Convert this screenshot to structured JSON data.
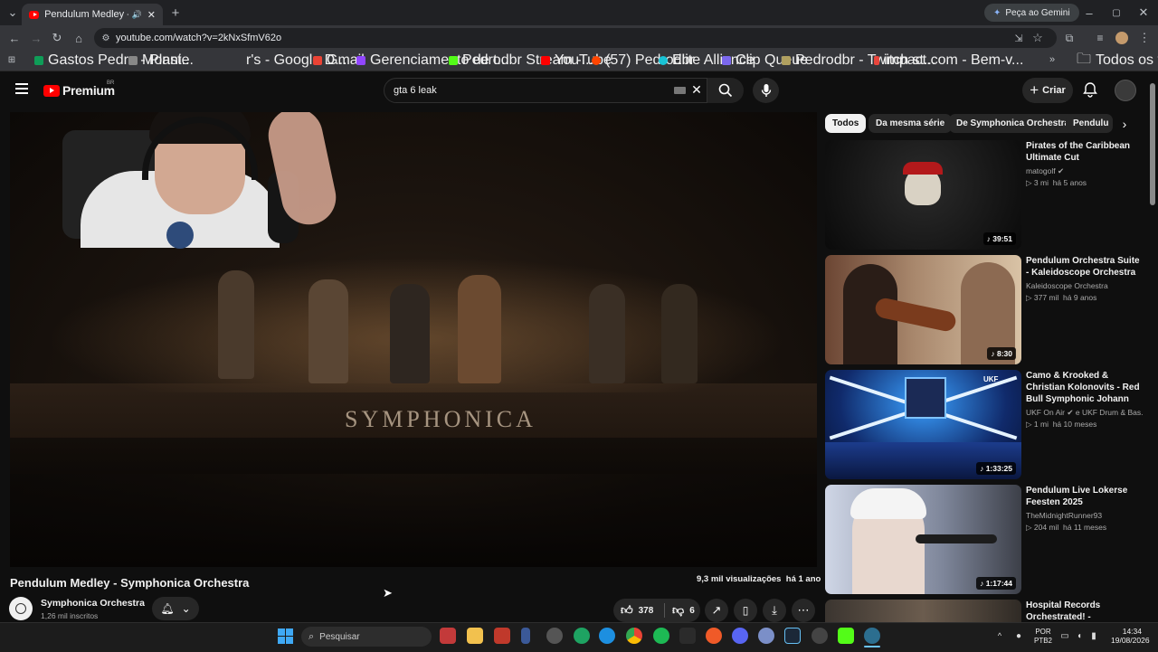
{
  "browser": {
    "tab_title": "Pendulum Medley - Symph",
    "url": "youtube.com/watch?v=2kNxSfmV62o",
    "gemini_label": "Peça ao Gemini",
    "bookmarks": [
      "Gastos Pedro - Plani...",
      "Monste",
      "r's - Google D...",
      "Gmail",
      "Gerenciamento de t...",
      "Pedrodbr Stream -...",
      "YouTube",
      "(57) Pedrodbr",
      "Elite Alliance",
      "Clip Queue",
      "Pedrodbr - Twitch st...",
      "impact.com - Bem-v..."
    ],
    "all_bookmarks": "Todos os favoritos"
  },
  "youtube": {
    "logo_text": "Premium",
    "country": "BR",
    "search_value": "gta 6 leak",
    "create_label": "Criar",
    "chips": [
      "Todos",
      "Da mesma série",
      "De Symphonica Orchestra",
      "Pendulu"
    ],
    "video": {
      "overlay_text": "SYMPHONICA",
      "title": "Pendulum Medley - Symphonica Orchestra",
      "views": "9,3 mil visualizações",
      "age": "há 1 ano",
      "channel": "Symphonica Orchestra",
      "subs": "1,26 mil inscritos",
      "likes": "378",
      "dislikes": "6"
    },
    "recommendations": [
      {
        "title": "Pirates of the Caribbean Ultimate Cut",
        "channel": "matogolf",
        "verified": true,
        "views": "3 mi",
        "age": "há 5 anos",
        "duration": "39:51"
      },
      {
        "title": "Pendulum Orchestra Suite - Kaleidoscope Orchestra",
        "channel": "Kaleidoscope Orchestra",
        "verified": false,
        "views": "377 mil",
        "age": "há 9 anos",
        "duration": "8:30"
      },
      {
        "title": "Camo & Krooked & Christian Kolonovits - Red Bull Symphonic Johann Strauss ...",
        "channel": "UKF On Air",
        "channel_extra": "e UKF Drum & Bas...",
        "verified": true,
        "views": "1 mi",
        "age": "há 10 meses",
        "duration": "1:33:25"
      },
      {
        "title": "Pendulum Live Lokerse Feesten 2025",
        "channel": "TheMidnightRunner93",
        "verified": false,
        "views": "204 mil",
        "age": "há 11 meses",
        "duration": "1:17:44"
      },
      {
        "title": "Hospital Records Orchestrated! - Symphonica",
        "channel": "",
        "verified": false,
        "views": "",
        "age": "",
        "duration": ""
      }
    ]
  },
  "taskbar": {
    "search_placeholder": "Pesquisar",
    "lang": "POR",
    "layout": "PTB2",
    "time": "14:34",
    "date": "19/08/2026"
  },
  "colors": {
    "accent_red": "#ff0000",
    "bg": "#0f0f0f"
  }
}
